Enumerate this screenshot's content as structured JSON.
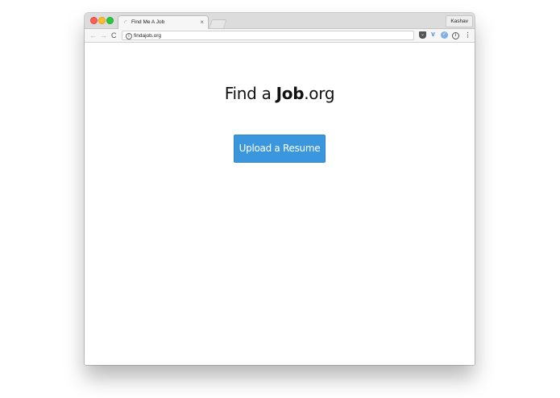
{
  "browser": {
    "tab": {
      "title": "Find Me A Job",
      "favicon": "loading-spinner-icon",
      "close_glyph": "×"
    },
    "profile_name": "Kashav",
    "address_bar": {
      "url": "findajob.org",
      "info_glyph": "i"
    },
    "nav": {
      "back_glyph": "←",
      "forward_glyph": "→",
      "reload_glyph": "C"
    },
    "extensions": {
      "pocket_glyph": "⌄",
      "v_glyph": "V",
      "circle_glyph": "✓",
      "info_glyph": "i",
      "menu_glyph": "⋮"
    }
  },
  "page": {
    "headline": {
      "prefix": "Find a ",
      "bold": "Job",
      "suffix": ".org"
    },
    "upload_button_label": "Upload a Resume",
    "button_color": "#3b97dd"
  }
}
